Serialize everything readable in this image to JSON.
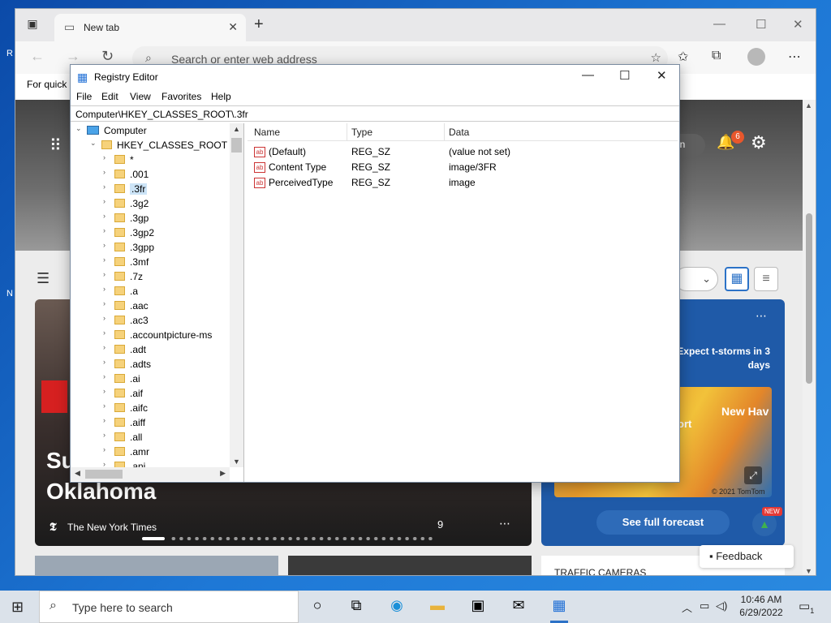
{
  "browser": {
    "tab_title": "New tab",
    "address_placeholder": "Search or enter web address",
    "favorites_bar": "For quick"
  },
  "newtab_page": {
    "notifications_count": "6",
    "signin_fragment": "in",
    "news_headline": "Su\nOklahoma",
    "news_source": "The New York Times",
    "news_reactions": "9",
    "weather_text": "Expect t-storms in 3 days",
    "map_label_new_haven": "New Hav",
    "map_label_port": "ort",
    "map_copyright": "© 2021 TomTom",
    "see_forecast": "See full forecast",
    "new_badge": "NEW",
    "traffic_cameras": "TRAFFIC CAMERAS",
    "feedback": "Feedback"
  },
  "regedit": {
    "title": "Registry Editor",
    "menu": [
      "File",
      "Edit",
      "View",
      "Favorites",
      "Help"
    ],
    "path": "Computer\\HKEY_CLASSES_ROOT\\.3fr",
    "tree": {
      "computer": "Computer",
      "root": "HKEY_CLASSES_ROOT",
      "keys": [
        "*",
        ".001",
        ".3fr",
        ".3g2",
        ".3gp",
        ".3gp2",
        ".3gpp",
        ".3mf",
        ".7z",
        ".a",
        ".aac",
        ".ac3",
        ".accountpicture-ms",
        ".adt",
        ".adts",
        ".ai",
        ".aif",
        ".aifc",
        ".aiff",
        ".all",
        ".amr",
        ".ani"
      ],
      "selected": ".3fr"
    },
    "columns": {
      "name": "Name",
      "type": "Type",
      "data": "Data"
    },
    "values": [
      {
        "name": "(Default)",
        "type": "REG_SZ",
        "data": "(value not set)"
      },
      {
        "name": "Content Type",
        "type": "REG_SZ",
        "data": "image/3FR"
      },
      {
        "name": "PerceivedType",
        "type": "REG_SZ",
        "data": "image"
      }
    ]
  },
  "taskbar": {
    "search_placeholder": "Type here to search",
    "time": "10:46 AM",
    "date": "6/29/2022",
    "notification_count": "1"
  },
  "desktop": {
    "icon_labels": [
      "R",
      "N"
    ]
  }
}
